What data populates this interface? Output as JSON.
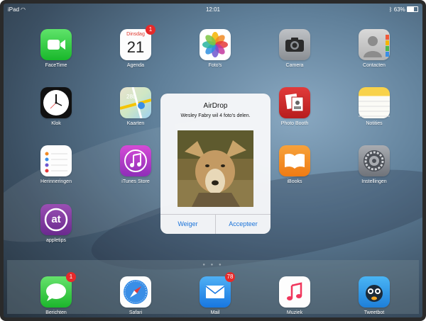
{
  "status_bar": {
    "device": "iPad",
    "time": "12:01",
    "battery": "63%"
  },
  "apps": [
    {
      "name": "FaceTime",
      "icon": "facetime-icon"
    },
    {
      "name": "Agenda",
      "icon": "calendar-icon",
      "weekday": "Dinsdag",
      "day": "21",
      "badge": "1"
    },
    {
      "name": "Foto's",
      "icon": "photos-icon"
    },
    {
      "name": "Camera",
      "icon": "camera-icon"
    },
    {
      "name": "Contacten",
      "icon": "contacts-icon"
    },
    {
      "name": "Klok",
      "icon": "clock-icon"
    },
    {
      "name": "Kaarten",
      "icon": "maps-icon"
    },
    {
      "name": "Photo Booth",
      "icon": "photo-booth-icon"
    },
    {
      "name": "Notities",
      "icon": "notes-icon"
    },
    {
      "name": "Herinneringen",
      "icon": "reminders-icon"
    },
    {
      "name": "iTunes Store",
      "icon": "itunes-store-icon"
    },
    {
      "name": "iBooks",
      "icon": "ibooks-icon"
    },
    {
      "name": "Instellingen",
      "icon": "settings-icon"
    },
    {
      "name": "appletips",
      "icon": "appletips-icon",
      "glyph": "at"
    }
  ],
  "dock": [
    {
      "name": "Berichten",
      "icon": "messages-icon",
      "badge": "1"
    },
    {
      "name": "Safari",
      "icon": "safari-icon"
    },
    {
      "name": "Mail",
      "icon": "mail-icon",
      "badge": "78"
    },
    {
      "name": "Muziek",
      "icon": "music-icon"
    },
    {
      "name": "Tweetbot",
      "icon": "tweetbot-icon"
    }
  ],
  "airdrop": {
    "title": "AirDrop",
    "message": "Wesley Fabry wil 4 foto's delen.",
    "decline": "Weiger",
    "accept": "Accepteer"
  }
}
